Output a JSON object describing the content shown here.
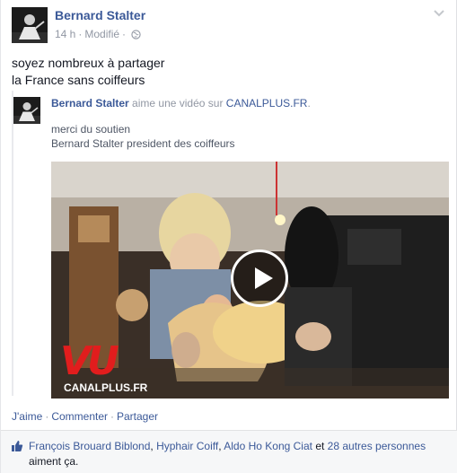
{
  "post": {
    "author": "Bernard Stalter",
    "time": "14 h",
    "edited": "Modifié",
    "message_line1": "soyez nombreux à partager",
    "message_line2": "la France sans coiffeurs"
  },
  "shared": {
    "name": "Bernard Stalter",
    "action": "aime une vidéo sur",
    "site": "CANALPLUS.FR",
    "text_line1": "merci du soutien",
    "text_line2": "Bernard Stalter president des coiffeurs"
  },
  "video": {
    "logo": "VU",
    "watermark": "CANALPLUS.FR"
  },
  "actions": {
    "like": "J'aime",
    "comment": "Commenter",
    "share": "Partager"
  },
  "likes": {
    "person1": "François Brouard Biblond",
    "person2": "Hyphair Coiff",
    "person3": "Aldo Ho Kong Ciat",
    "and": "et",
    "others": "28 autres personnes",
    "suffix": "aiment ça."
  },
  "colors": {
    "link": "#3b5998",
    "muted": "#9197a3",
    "vu_red": "#e11d1d"
  },
  "icons": [
    "chevron-down-icon",
    "globe-icon",
    "play-icon",
    "like-thumb-icon"
  ]
}
